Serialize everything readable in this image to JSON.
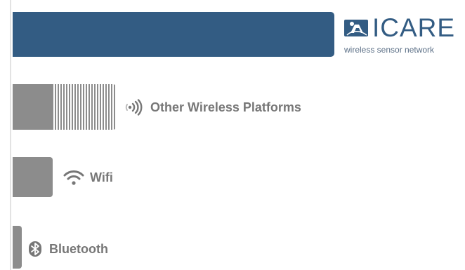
{
  "logo": {
    "name": "ICARE",
    "tagline": "wireless sensor network",
    "icon": "lab-flask-logo-icon"
  },
  "colors": {
    "brand_blue": "#335c83",
    "tile_gray": "#8c8c8c",
    "text_gray": "#777777"
  },
  "platforms": [
    {
      "label": "Other Wireless Platforms",
      "icon": "signal-waves-icon"
    },
    {
      "label": "Wifi",
      "icon": "wifi-icon"
    },
    {
      "label": "Bluetooth",
      "icon": "bluetooth-icon"
    }
  ]
}
